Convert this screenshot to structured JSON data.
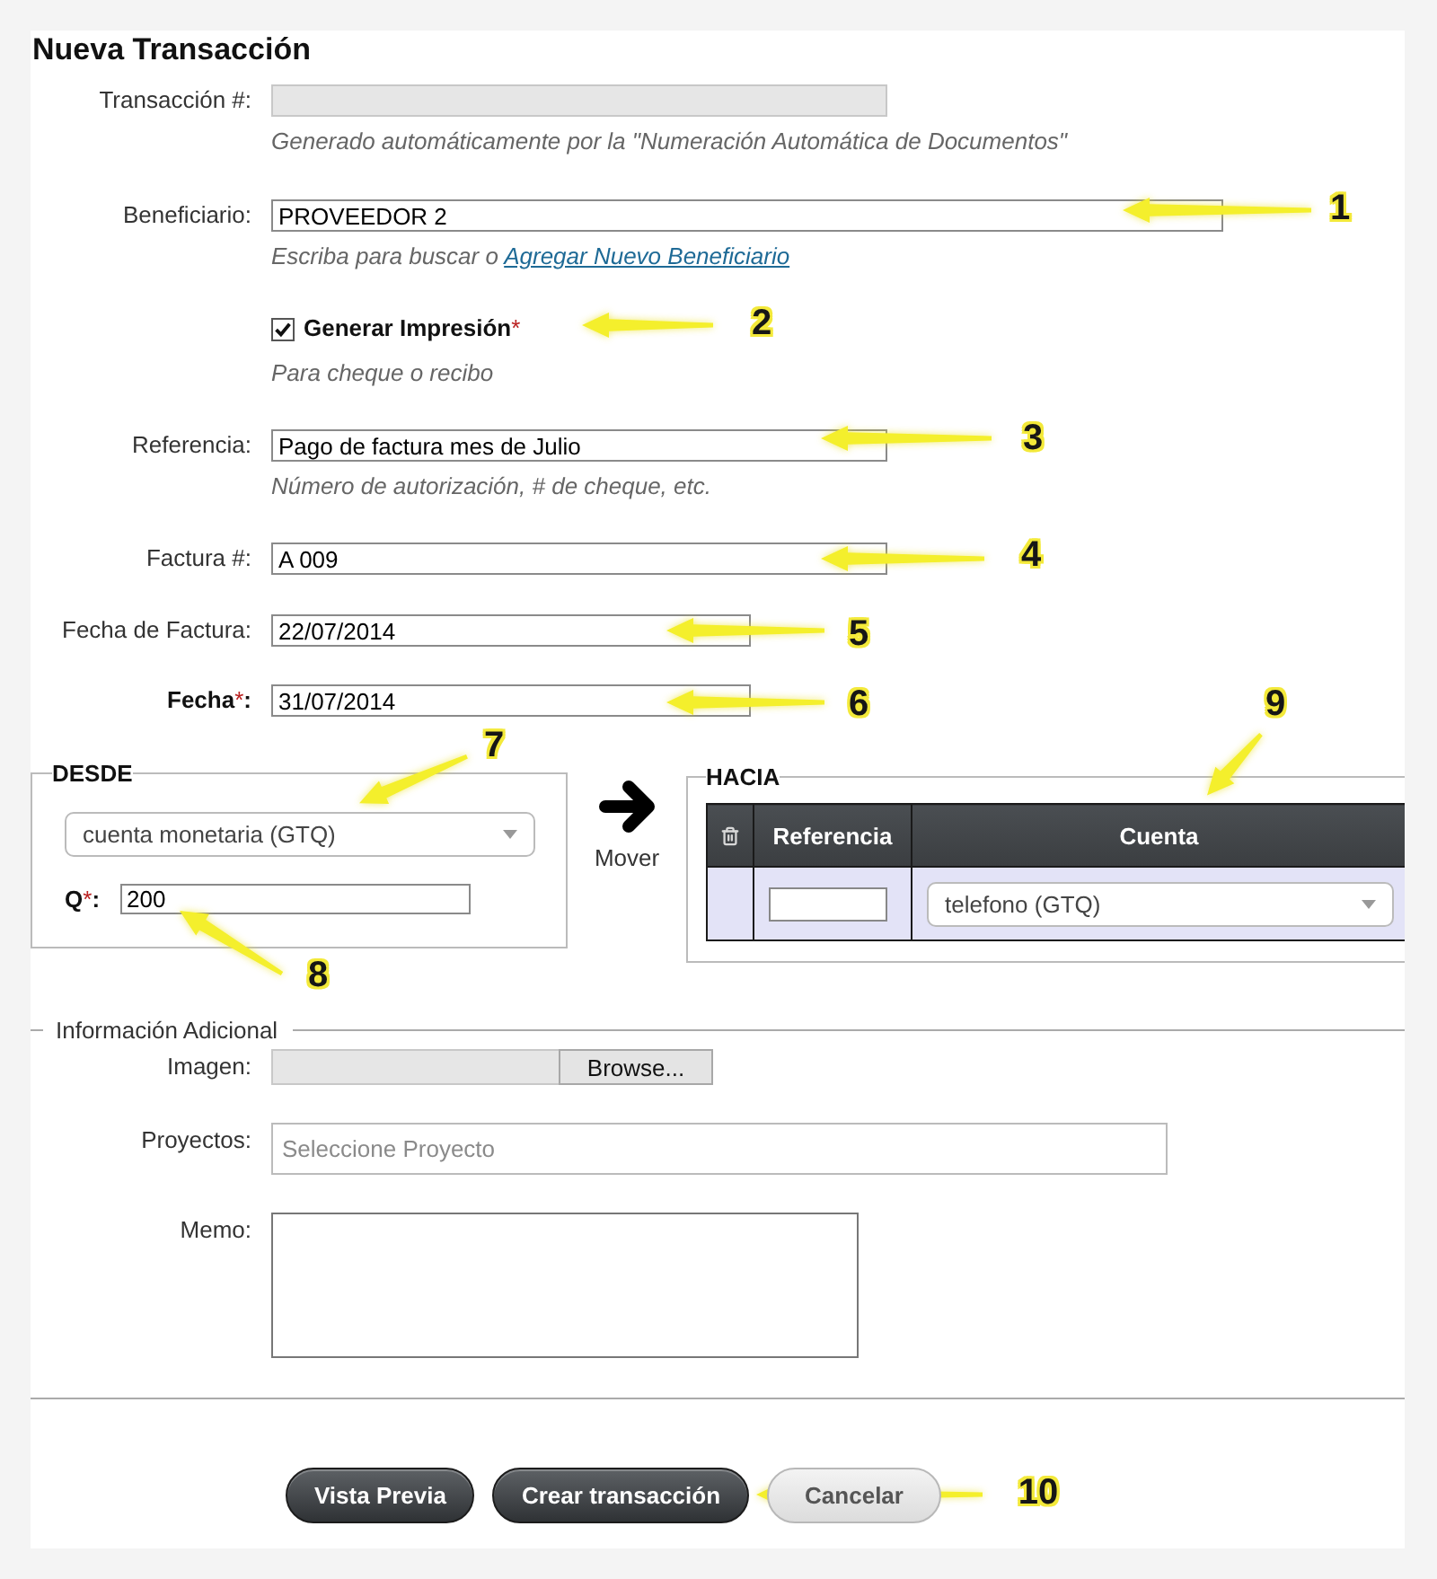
{
  "title": "Nueva Transacción",
  "transaction_number": {
    "label": "Transacción #:",
    "disabled": true,
    "hint": "Generado automáticamente por la \"Numeración Automática de Documentos\""
  },
  "beneficiary": {
    "label": "Beneficiario:",
    "value": "PROVEEDOR 2",
    "hint": "Escriba para buscar o",
    "hint_link": "Agregar Nuevo Beneficiario"
  },
  "print": {
    "label": "Generar Impresión",
    "required_mark": "*",
    "checked": true,
    "hint": "Para cheque o recibo"
  },
  "reference": {
    "label": "Referencia:",
    "value": "Pago de factura mes de Julio",
    "hint": "Número de autorización, # de cheque, etc."
  },
  "invoice_number": {
    "label": "Factura #:",
    "value": "A 009"
  },
  "invoice_date": {
    "label": "Fecha de Factura:",
    "value": "22/07/2014"
  },
  "date": {
    "label": "Fecha",
    "required_mark": "*",
    "label_end": ":",
    "value": "31/07/2014"
  },
  "from": {
    "legend": "DESDE",
    "account": "cuenta monetaria (GTQ)",
    "amount": {
      "label": "Q",
      "required_mark": "*",
      "label_end": ":",
      "value": "200"
    }
  },
  "move": {
    "label": "Mover"
  },
  "to": {
    "legend": "HACIA",
    "columns": [
      "Referencia",
      "Cuenta"
    ],
    "rows": [
      {
        "account": "telefono (GTQ)"
      }
    ]
  },
  "additional": {
    "legend": "Información Adicional",
    "image": {
      "label": "Imagen:",
      "button": "Browse..."
    },
    "projects": {
      "label": "Proyectos:",
      "placeholder": "Seleccione Proyecto"
    },
    "memo": {
      "label": "Memo:"
    }
  },
  "buttons": [
    {
      "label": "Vista Previa",
      "kind": "primary"
    },
    {
      "label": "Crear transacción",
      "kind": "primary"
    },
    {
      "label": "Cancelar",
      "kind": "secondary"
    }
  ],
  "callouts": [
    {
      "number": "1"
    },
    {
      "number": "2"
    },
    {
      "number": "3"
    },
    {
      "number": "4"
    },
    {
      "number": "5"
    },
    {
      "number": "6"
    },
    {
      "number": "7"
    },
    {
      "number": "8"
    },
    {
      "number": "9"
    },
    {
      "number": "10"
    }
  ]
}
